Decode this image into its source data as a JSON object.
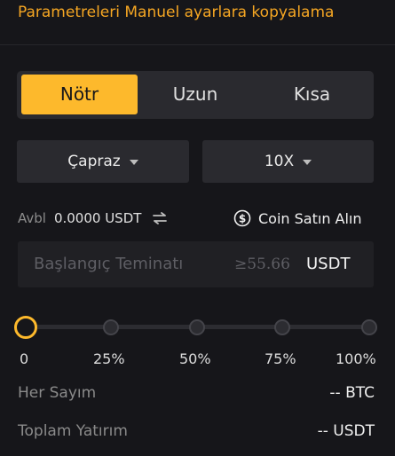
{
  "header": {
    "title": "Parametreleri Manuel ayarlara kopyalama"
  },
  "direction_tabs": [
    {
      "label": "Nötr",
      "active": true
    },
    {
      "label": "Uzun",
      "active": false
    },
    {
      "label": "Kısa",
      "active": false
    }
  ],
  "margin_mode": {
    "value": "Çapraz"
  },
  "leverage": {
    "value": "10X"
  },
  "available": {
    "label": "Avbl",
    "value": "0.0000 USDT"
  },
  "buy_coin": {
    "label": "Coin Satın Alın"
  },
  "amount": {
    "placeholder": "Başlangıç Teminatı",
    "min": "≥55.66",
    "unit": "USDT"
  },
  "slider": {
    "value_percent": 0,
    "labels": [
      "0",
      "25%",
      "50%",
      "75%",
      "100%"
    ]
  },
  "per_order": {
    "label": "Her Sayım",
    "value": "-- BTC"
  },
  "total_investment": {
    "label": "Toplam Yatırım",
    "value": "-- USDT"
  },
  "colors": {
    "accent": "#fdb92c",
    "title": "#f5a623",
    "background": "#16161a"
  },
  "icons": {
    "swap": "swap-icon",
    "dollar": "dollar-circle-icon",
    "caret": "chevron-down-icon"
  }
}
